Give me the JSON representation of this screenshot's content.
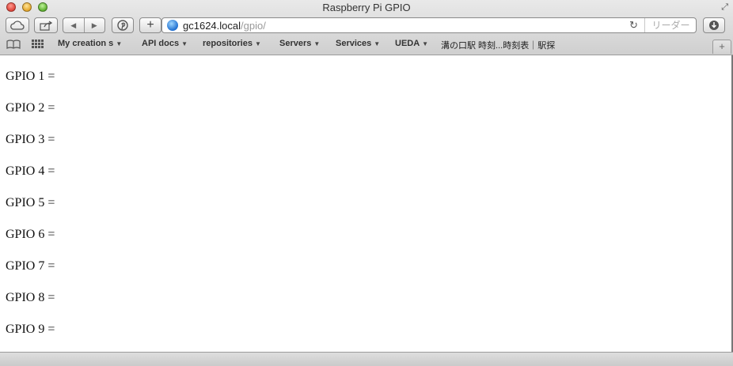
{
  "window": {
    "title": "Raspberry Pi GPIO"
  },
  "toolbar": {
    "url_host": "gc1624.local",
    "url_path": "/gpio/",
    "reader_label": "リーダー"
  },
  "bookmarks": [
    {
      "label": "My creation s"
    },
    {
      "label": "API docs"
    },
    {
      "label": "repositories"
    },
    {
      "label": "Servers"
    },
    {
      "label": "Services"
    },
    {
      "label": "UEDA"
    },
    {
      "label": "溝の口駅 時刻...時刻表｜駅探"
    }
  ],
  "page": {
    "gpio": [
      {
        "label": "GPIO 1 ="
      },
      {
        "label": "GPIO 2 ="
      },
      {
        "label": "GPIO 3 ="
      },
      {
        "label": "GPIO 4 ="
      },
      {
        "label": "GPIO 5 ="
      },
      {
        "label": "GPIO 6 ="
      },
      {
        "label": "GPIO 7 ="
      },
      {
        "label": "GPIO 8 ="
      },
      {
        "label": "GPIO 9 ="
      }
    ]
  }
}
